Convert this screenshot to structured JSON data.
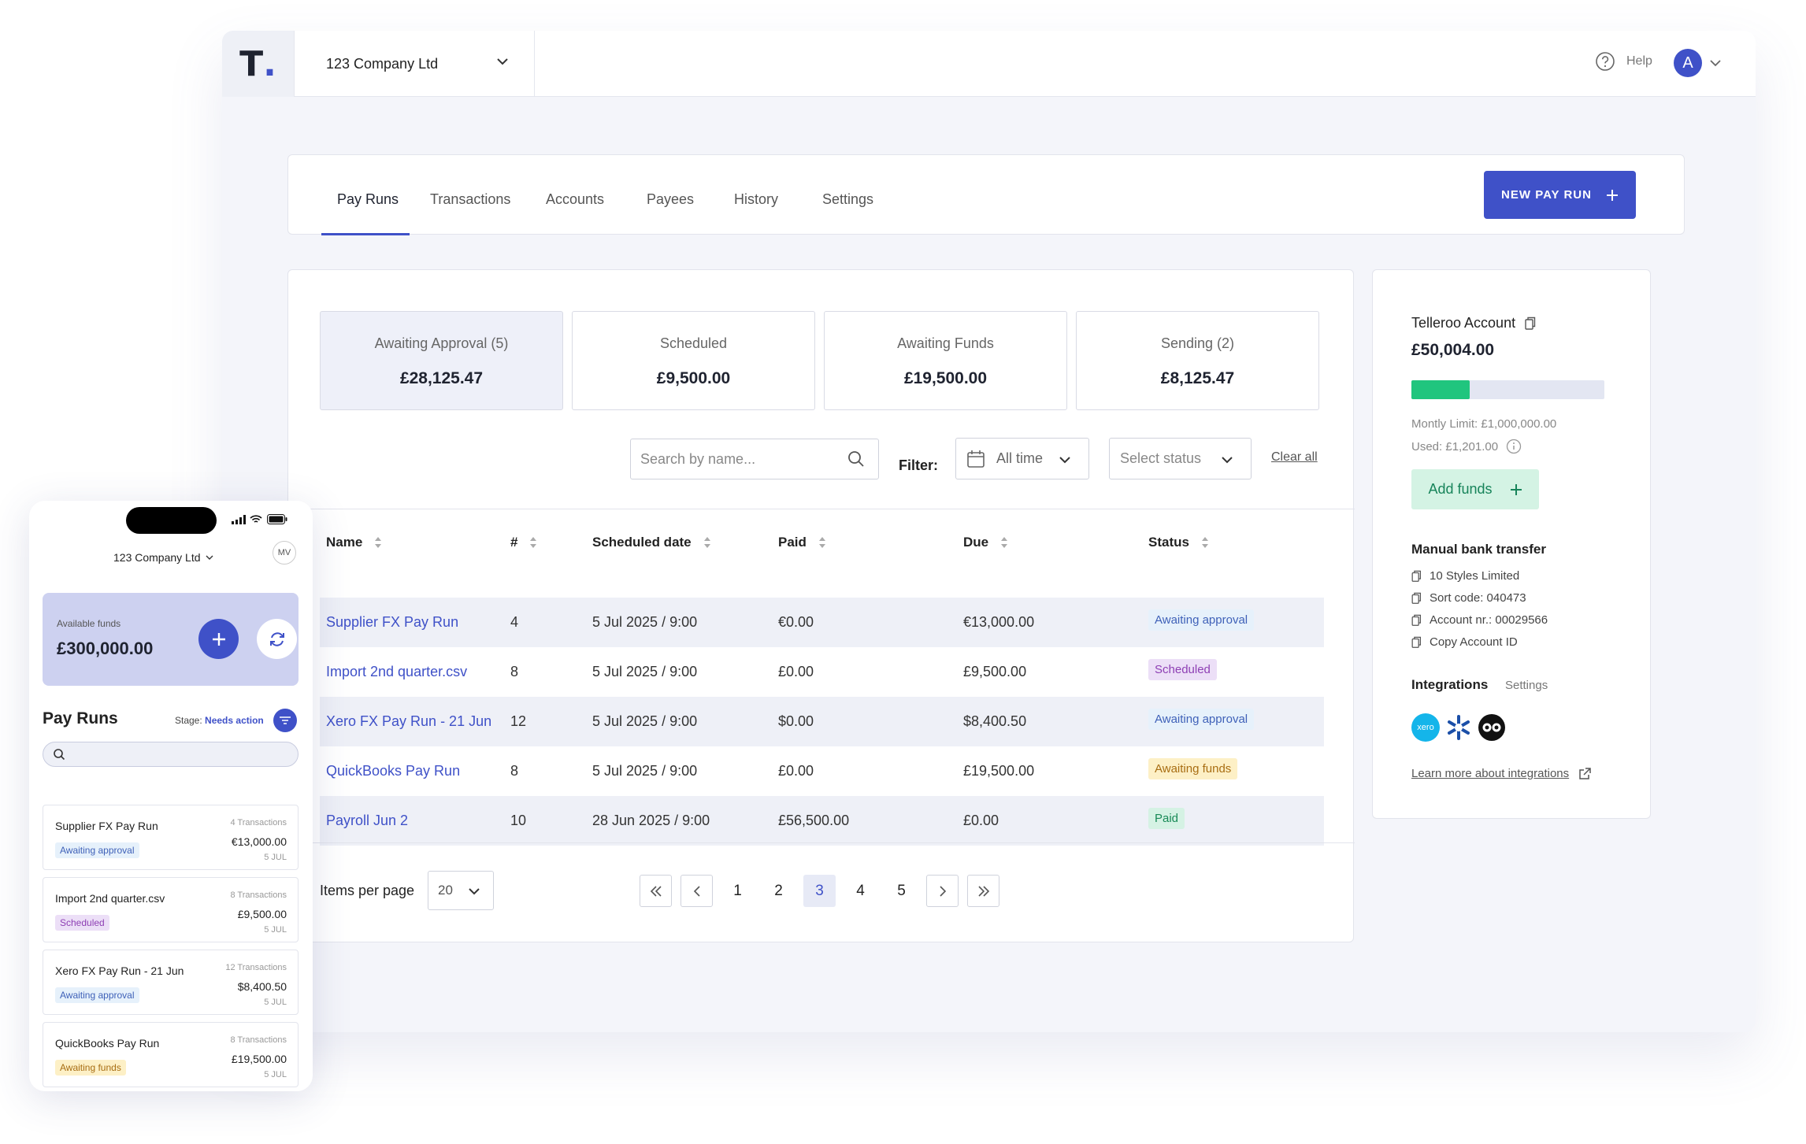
{
  "topbar": {
    "logo_letter": "T",
    "logo_dot": ".",
    "company": "123 Company Ltd",
    "help": "Help",
    "avatar_initial": "A"
  },
  "tabs": [
    {
      "label": "Pay Runs",
      "active": true
    },
    {
      "label": "Transactions"
    },
    {
      "label": "Accounts"
    },
    {
      "label": "Payees"
    },
    {
      "label": "History"
    },
    {
      "label": "Settings"
    }
  ],
  "new_pay_run": "NEW PAY RUN",
  "summary": [
    {
      "label": "Awaiting Approval (5)",
      "value": "£28,125.47",
      "active": true
    },
    {
      "label": "Scheduled",
      "value": "£9,500.00"
    },
    {
      "label": "Awaiting Funds",
      "value": "£19,500.00"
    },
    {
      "label": "Sending (2)",
      "value": "£8,125.47"
    }
  ],
  "filters": {
    "search_placeholder": "Search by name...",
    "filter_label": "Filter:",
    "date_value": "All time",
    "status_placeholder": "Select status",
    "clear_all": "Clear all"
  },
  "table": {
    "headers": [
      "Name",
      "#",
      "Scheduled date",
      "Paid",
      "Due",
      "Status"
    ],
    "rows": [
      {
        "name": "Supplier FX Pay Run",
        "count": "4",
        "date": "5 Jul 2025 / 9:00",
        "paid": "€0.00",
        "due": "€13,000.00",
        "status": "Awaiting approval",
        "status_type": "await"
      },
      {
        "name": "Import 2nd quarter.csv",
        "count": "8",
        "date": "5 Jul 2025 / 9:00",
        "paid": "£0.00",
        "due": "£9,500.00",
        "status": "Scheduled",
        "status_type": "sched"
      },
      {
        "name": "Xero FX Pay Run - 21 Jun",
        "count": "12",
        "date": "5 Jul 2025 / 9:00",
        "paid": "$0.00",
        "due": "$8,400.50",
        "status": "Awaiting approval",
        "status_type": "await"
      },
      {
        "name": "QuickBooks Pay Run",
        "count": "8",
        "date": "5 Jul 2025 / 9:00",
        "paid": "£0.00",
        "due": "£19,500.00",
        "status": "Awaiting funds",
        "status_type": "funds"
      },
      {
        "name": "Payroll Jun 2",
        "count": "10",
        "date": "28 Jun 2025 / 9:00",
        "paid": "£56,500.00",
        "due": "£0.00",
        "status": "Paid",
        "status_type": "paid"
      }
    ]
  },
  "pagination": {
    "items_per_page_label": "Items per page",
    "items_per_page": "20",
    "pages": [
      "1",
      "2",
      "3",
      "4",
      "5"
    ],
    "current": "3"
  },
  "account": {
    "title": "Telleroo Account",
    "balance": "£50,004.00",
    "usage_fraction": 0.3,
    "limit": "Montly Limit: £1,000,000.00",
    "used": "Used: £1,201.00",
    "add_funds": "Add funds",
    "manual_title": "Manual bank transfer",
    "manual_items": [
      "10 Styles Limited",
      "Sort code: 040473",
      "Account nr.: 00029566",
      "Copy Account ID"
    ],
    "integrations_title": "Integrations",
    "integrations_settings": "Settings",
    "xero_label": "xero",
    "learn_more": "Learn more about integrations"
  },
  "phone": {
    "company": "123 Company Ltd",
    "avatar": "MV",
    "available_label": "Available funds",
    "available_value": "£300,000.00",
    "title": "Pay Runs",
    "stage_label": "Stage:",
    "stage_value": "Needs action",
    "cards": [
      {
        "name": "Supplier FX Pay Run",
        "tx": "4 Transactions",
        "amount": "€13,000.00",
        "date": "5 JUL",
        "status": "Awaiting approval",
        "status_type": "await"
      },
      {
        "name": "Import 2nd quarter.csv",
        "tx": "8 Transactions",
        "amount": "£9,500.00",
        "date": "5 JUL",
        "status": "Scheduled",
        "status_type": "sched"
      },
      {
        "name": "Xero FX Pay Run - 21 Jun",
        "tx": "12 Transactions",
        "amount": "$8,400.50",
        "date": "5 JUL",
        "status": "Awaiting approval",
        "status_type": "await"
      },
      {
        "name": "QuickBooks Pay Run",
        "tx": "8 Transactions",
        "amount": "£19,500.00",
        "date": "5 JUL",
        "status": "Awaiting funds",
        "status_type": "funds"
      }
    ]
  },
  "colors": {
    "brand": "#3f51c8",
    "success": "#20c57e",
    "background": "#f4f5fa"
  }
}
